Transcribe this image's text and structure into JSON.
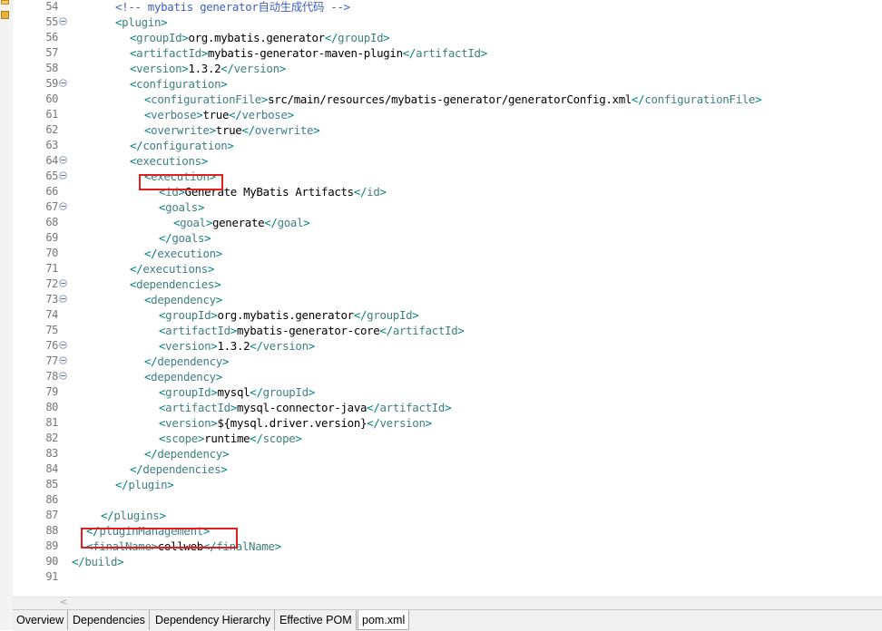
{
  "editor": {
    "lines": [
      {
        "num": "54",
        "fold": false,
        "indent": 3,
        "html": "<span class=\"cmt\">&lt;!-- mybatis generator自动生成代码 --&gt;</span>"
      },
      {
        "num": "55",
        "fold": true,
        "indent": 3,
        "html": "<span class=\"bracket\">&lt;</span><span class=\"tag\">plugin</span><span class=\"bracket\">&gt;</span>"
      },
      {
        "num": "56",
        "fold": false,
        "indent": 4,
        "html": "<span class=\"bracket\">&lt;</span><span class=\"tag\">groupId</span><span class=\"bracket\">&gt;</span><span class=\"txt\">org.mybatis.generator</span><span class=\"bracket\">&lt;/</span><span class=\"tag\">groupId</span><span class=\"bracket\">&gt;</span>"
      },
      {
        "num": "57",
        "fold": false,
        "indent": 4,
        "html": "<span class=\"bracket\">&lt;</span><span class=\"tag\">artifactId</span><span class=\"bracket\">&gt;</span><span class=\"txt\">mybatis-generator-maven-plugin</span><span class=\"bracket\">&lt;/</span><span class=\"tag\">artifactId</span><span class=\"bracket\">&gt;</span>"
      },
      {
        "num": "58",
        "fold": false,
        "indent": 4,
        "html": "<span class=\"bracket\">&lt;</span><span class=\"tag\">version</span><span class=\"bracket\">&gt;</span><span class=\"txt\">1.3.2</span><span class=\"bracket\">&lt;/</span><span class=\"tag\">version</span><span class=\"bracket\">&gt;</span>"
      },
      {
        "num": "59",
        "fold": true,
        "indent": 4,
        "html": "<span class=\"bracket\">&lt;</span><span class=\"tag\">configuration</span><span class=\"bracket\">&gt;</span>"
      },
      {
        "num": "60",
        "fold": false,
        "indent": 5,
        "html": "<span class=\"bracket\">&lt;</span><span class=\"tag\">configurationFile</span><span class=\"bracket\">&gt;</span><span class=\"txt\">src/main/resources/mybatis-generator/generatorConfig.xml</span><span class=\"bracket\">&lt;/</span><span class=\"tag\">configurationFile</span><span class=\"bracket\">&gt;</span>"
      },
      {
        "num": "61",
        "fold": false,
        "indent": 5,
        "html": "<span class=\"bracket\">&lt;</span><span class=\"tag\">verbose</span><span class=\"bracket\">&gt;</span><span class=\"txt\">true</span><span class=\"bracket\">&lt;/</span><span class=\"tag\">verbose</span><span class=\"bracket\">&gt;</span>"
      },
      {
        "num": "62",
        "fold": false,
        "indent": 5,
        "html": "<span class=\"bracket\">&lt;</span><span class=\"tag\">overwrite</span><span class=\"bracket\">&gt;</span><span class=\"txt\">true</span><span class=\"bracket\">&lt;/</span><span class=\"tag\">overwrite</span><span class=\"bracket\">&gt;</span>"
      },
      {
        "num": "63",
        "fold": false,
        "indent": 4,
        "html": "<span class=\"bracket\">&lt;/</span><span class=\"tag\">configuration</span><span class=\"bracket\">&gt;</span>"
      },
      {
        "num": "64",
        "fold": true,
        "indent": 4,
        "html": "<span class=\"bracket\">&lt;</span><span class=\"tag\">executions</span><span class=\"bracket\">&gt;</span>"
      },
      {
        "num": "65",
        "fold": true,
        "indent": 5,
        "html": "<span class=\"bracket\">&lt;</span><span class=\"tag\">execution</span><span class=\"bracket\">&gt;</span>"
      },
      {
        "num": "66",
        "fold": false,
        "indent": 6,
        "html": "<span class=\"bracket\">&lt;</span><span class=\"tag\">id</span><span class=\"bracket\">&gt;</span><span class=\"txt\">Generate MyBatis Artifacts</span><span class=\"bracket\">&lt;/</span><span class=\"tag\">id</span><span class=\"bracket\">&gt;</span>"
      },
      {
        "num": "67",
        "fold": true,
        "indent": 6,
        "html": "<span class=\"bracket\">&lt;</span><span class=\"tag\">goals</span><span class=\"bracket\">&gt;</span>"
      },
      {
        "num": "68",
        "fold": false,
        "indent": 7,
        "html": "<span class=\"bracket\">&lt;</span><span class=\"tag\">goal</span><span class=\"bracket\">&gt;</span><span class=\"txt\">generate</span><span class=\"bracket\">&lt;/</span><span class=\"tag\">goal</span><span class=\"bracket\">&gt;</span>"
      },
      {
        "num": "69",
        "fold": false,
        "indent": 6,
        "html": "<span class=\"bracket\">&lt;/</span><span class=\"tag\">goals</span><span class=\"bracket\">&gt;</span>"
      },
      {
        "num": "70",
        "fold": false,
        "indent": 5,
        "html": "<span class=\"bracket\">&lt;/</span><span class=\"tag\">execution</span><span class=\"bracket\">&gt;</span>"
      },
      {
        "num": "71",
        "fold": false,
        "indent": 4,
        "html": "<span class=\"bracket\">&lt;/</span><span class=\"tag\">executions</span><span class=\"bracket\">&gt;</span>"
      },
      {
        "num": "72",
        "fold": true,
        "indent": 4,
        "html": "<span class=\"bracket\">&lt;</span><span class=\"tag\">dependencies</span><span class=\"bracket\">&gt;</span>"
      },
      {
        "num": "73",
        "fold": true,
        "indent": 5,
        "html": "<span class=\"bracket\">&lt;</span><span class=\"tag\">dependency</span><span class=\"bracket\">&gt;</span>"
      },
      {
        "num": "74",
        "fold": false,
        "indent": 6,
        "html": "<span class=\"bracket\">&lt;</span><span class=\"tag\">groupId</span><span class=\"bracket\">&gt;</span><span class=\"txt\">org.mybatis.generator</span><span class=\"bracket\">&lt;/</span><span class=\"tag\">groupId</span><span class=\"bracket\">&gt;</span>"
      },
      {
        "num": "75",
        "fold": false,
        "indent": 6,
        "html": "<span class=\"bracket\">&lt;</span><span class=\"tag\">artifactId</span><span class=\"bracket\">&gt;</span><span class=\"txt\">mybatis-generator-core</span><span class=\"bracket\">&lt;/</span><span class=\"tag\">artifactId</span><span class=\"bracket\">&gt;</span>"
      },
      {
        "num": "76",
        "fold": true,
        "indent": 6,
        "html": "<span class=\"bracket\">&lt;</span><span class=\"tag\">version</span><span class=\"bracket\">&gt;</span><span class=\"txt\">1.3.2</span><span class=\"bracket\">&lt;/</span><span class=\"tag\">version</span><span class=\"bracket\">&gt;</span>"
      },
      {
        "num": "77",
        "fold": true,
        "indent": 5,
        "html": "<span class=\"bracket\">&lt;/</span><span class=\"tag\">dependency</span><span class=\"bracket\">&gt;</span>"
      },
      {
        "num": "78",
        "fold": true,
        "indent": 5,
        "html": "<span class=\"bracket\">&lt;</span><span class=\"tag\">dependency</span><span class=\"bracket\">&gt;</span>"
      },
      {
        "num": "79",
        "fold": false,
        "indent": 6,
        "html": "<span class=\"bracket\">&lt;</span><span class=\"tag\">groupId</span><span class=\"bracket\">&gt;</span><span class=\"txt\">mysql</span><span class=\"bracket\">&lt;/</span><span class=\"tag\">groupId</span><span class=\"bracket\">&gt;</span>"
      },
      {
        "num": "80",
        "fold": false,
        "indent": 6,
        "html": "<span class=\"bracket\">&lt;</span><span class=\"tag\">artifactId</span><span class=\"bracket\">&gt;</span><span class=\"txt\">mysql-connector-java</span><span class=\"bracket\">&lt;/</span><span class=\"tag\">artifactId</span><span class=\"bracket\">&gt;</span>"
      },
      {
        "num": "81",
        "fold": false,
        "indent": 6,
        "html": "<span class=\"bracket\">&lt;</span><span class=\"tag\">version</span><span class=\"bracket\">&gt;</span><span class=\"txt\">${mysql.driver.version}</span><span class=\"bracket\">&lt;/</span><span class=\"tag\">version</span><span class=\"bracket\">&gt;</span>"
      },
      {
        "num": "82",
        "fold": false,
        "indent": 6,
        "html": "<span class=\"bracket\">&lt;</span><span class=\"tag\">scope</span><span class=\"bracket\">&gt;</span><span class=\"txt\">runtime</span><span class=\"bracket\">&lt;/</span><span class=\"tag\">scope</span><span class=\"bracket\">&gt;</span>"
      },
      {
        "num": "83",
        "fold": false,
        "indent": 5,
        "html": "<span class=\"bracket\">&lt;/</span><span class=\"tag\">dependency</span><span class=\"bracket\">&gt;</span>"
      },
      {
        "num": "84",
        "fold": false,
        "indent": 4,
        "html": "<span class=\"bracket\">&lt;/</span><span class=\"tag\">dependencies</span><span class=\"bracket\">&gt;</span>"
      },
      {
        "num": "85",
        "fold": false,
        "indent": 3,
        "html": "<span class=\"bracket\">&lt;/</span><span class=\"tag\">plugin</span><span class=\"bracket\">&gt;</span>"
      },
      {
        "num": "86",
        "fold": false,
        "indent": 0,
        "html": ""
      },
      {
        "num": "87",
        "fold": false,
        "indent": 2,
        "html": "<span class=\"bracket\">&lt;/</span><span class=\"tag\">plugins</span><span class=\"bracket\">&gt;</span>"
      },
      {
        "num": "88",
        "fold": false,
        "indent": 1,
        "html": "<span class=\"bracket\">&lt;/</span><span class=\"tag\">pluginManagement</span><span class=\"bracket\">&gt;</span>"
      },
      {
        "num": "89",
        "fold": false,
        "indent": 1,
        "html": "<span class=\"bracket\">&lt;</span><span class=\"tag\">finalName</span><span class=\"bracket\">&gt;</span><span class=\"txt\">collweb</span><span class=\"bracket\">&lt;/</span><span class=\"tag\">finalName</span><span class=\"bracket\">&gt;</span>"
      },
      {
        "num": "90",
        "fold": false,
        "indent": 0,
        "html": "<span class=\"bracket\">&lt;/</span><span class=\"tag\">build</span><span class=\"bracket\">&gt;</span>"
      },
      {
        "num": "91",
        "fold": false,
        "indent": 0,
        "html": ""
      }
    ]
  },
  "scrollbar": {
    "left_arrow": "<"
  },
  "tabs": [
    {
      "label": "Overview",
      "active": false
    },
    {
      "label": "Dependencies",
      "active": false
    },
    {
      "label": "Dependency Hierarchy",
      "active": false
    },
    {
      "label": "Effective POM",
      "active": false
    },
    {
      "label": "pom.xml",
      "active": true
    }
  ],
  "colors": {
    "tag": "#3f7f7f",
    "bracket": "#008080",
    "comment": "#3f5fbf",
    "highlight_box": "#e21f1f"
  }
}
